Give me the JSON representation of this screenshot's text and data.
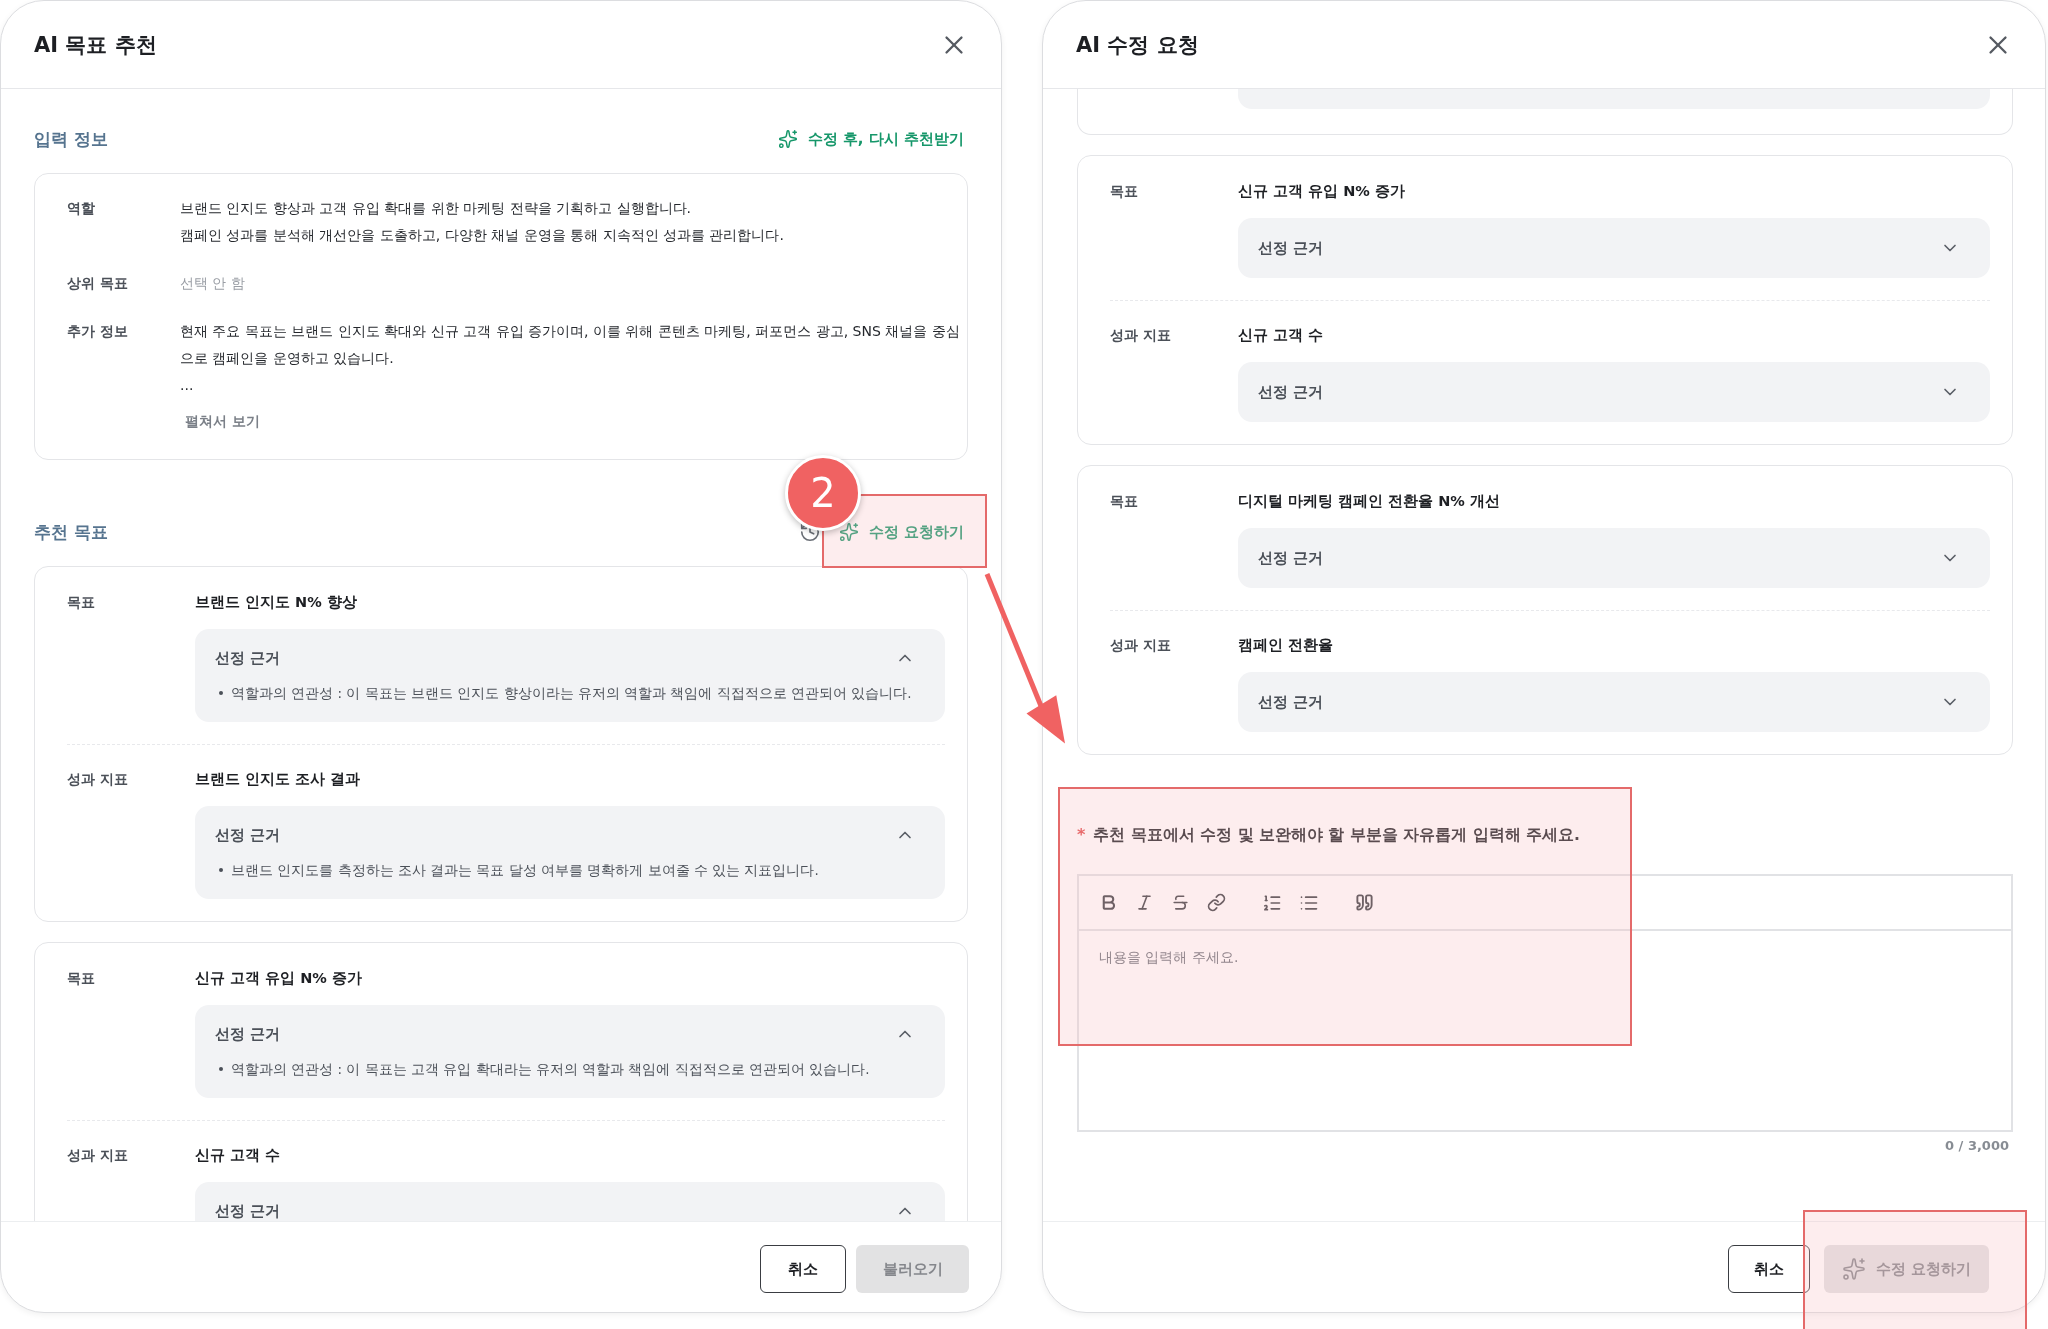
{
  "left_dialog": {
    "title": "AI 목표 추천",
    "input_section": {
      "title": "입력 정보",
      "action": "수정 후, 다시 추천받기",
      "fields": [
        {
          "label": "역할",
          "muted": false,
          "lines": [
            "브랜드 인지도 향상과 고객 유입 확대를 위한 마케팅 전략을 기획하고 실행합니다.",
            "캠페인 성과를 분석해 개선안을 도출하고, 다양한 채널 운영을 통해 지속적인 성과를 관리합니다."
          ]
        },
        {
          "label": "상위 목표",
          "muted": true,
          "lines": [
            "선택 안 함"
          ]
        },
        {
          "label": "추가 정보",
          "muted": false,
          "lines": [
            "현재 주요 목표는 브랜드 인지도 확대와 신규 고객 유입 증가이며, 이를 위해 콘텐츠 마케팅, 퍼포먼스 광고, SNS 채널을 중심",
            "으로 캠페인을 운영하고 있습니다.",
            "..."
          ]
        }
      ],
      "expand_link": "펼쳐서 보기"
    },
    "recommend_section": {
      "title": "추천 목표",
      "action": "수정 요청하기",
      "goals": [
        {
          "rows": [
            {
              "label": "목표",
              "value": "브랜드 인지도 N% 향상",
              "reason_title": "선정 근거",
              "expanded": true,
              "reason": "역할과의 연관성 : 이 목표는 브랜드 인지도 향상이라는 유저의 역할과 책임에 직접적으로 연관되어 있습니다."
            },
            {
              "label": "성과 지표",
              "value": "브랜드 인지도 조사 결과",
              "reason_title": "선정 근거",
              "expanded": true,
              "reason": "브랜드 인지도를 측정하는 조사 결과는 목표 달성 여부를 명확하게 보여줄 수 있는 지표입니다."
            }
          ]
        },
        {
          "rows": [
            {
              "label": "목표",
              "value": "신규 고객 유입 N% 증가",
              "reason_title": "선정 근거",
              "expanded": true,
              "reason": "역할과의 연관성 : 이 목표는 고객 유입 확대라는 유저의 역할과 책임에 직접적으로 연관되어 있습니다."
            },
            {
              "label": "성과 지표",
              "value": "신규 고객 수",
              "reason_title": "선정 근거",
              "expanded": true
            }
          ]
        }
      ]
    },
    "footer": {
      "buttons": [
        {
          "label": "취소",
          "disabled": false
        },
        {
          "label": "불러오기",
          "disabled": true
        }
      ]
    }
  },
  "right_dialog": {
    "title": "AI 수정 요청",
    "goals": [
      {
        "rows": [
          {
            "label": "목표",
            "value": "신규 고객 유입 N% 증가",
            "reason_title": "선정 근거",
            "expanded": false
          },
          {
            "label": "성과 지표",
            "value": "신규 고객 수",
            "reason_title": "선정 근거",
            "expanded": false
          }
        ]
      },
      {
        "rows": [
          {
            "label": "목표",
            "value": "디지털 마케팅 캠페인 전환율 N% 개선",
            "reason_title": "선정 근거",
            "expanded": false
          },
          {
            "label": "성과 지표",
            "value": "캠페인 전환율",
            "reason_title": "선정 근거",
            "expanded": false
          }
        ]
      }
    ],
    "editor": {
      "required_mark": "*",
      "label": "추천 목표에서 수정 및 보완해야 할 부분을 자유롭게 입력해 주세요.",
      "placeholder": "내용을 입력해 주세요.",
      "counter": "0 / 3,000"
    },
    "footer": {
      "buttons": [
        {
          "label": "취소",
          "disabled": false
        },
        {
          "label": "수정 요청하기",
          "disabled": true,
          "icon": true
        }
      ]
    }
  },
  "annotation": {
    "step_badge": "2"
  }
}
